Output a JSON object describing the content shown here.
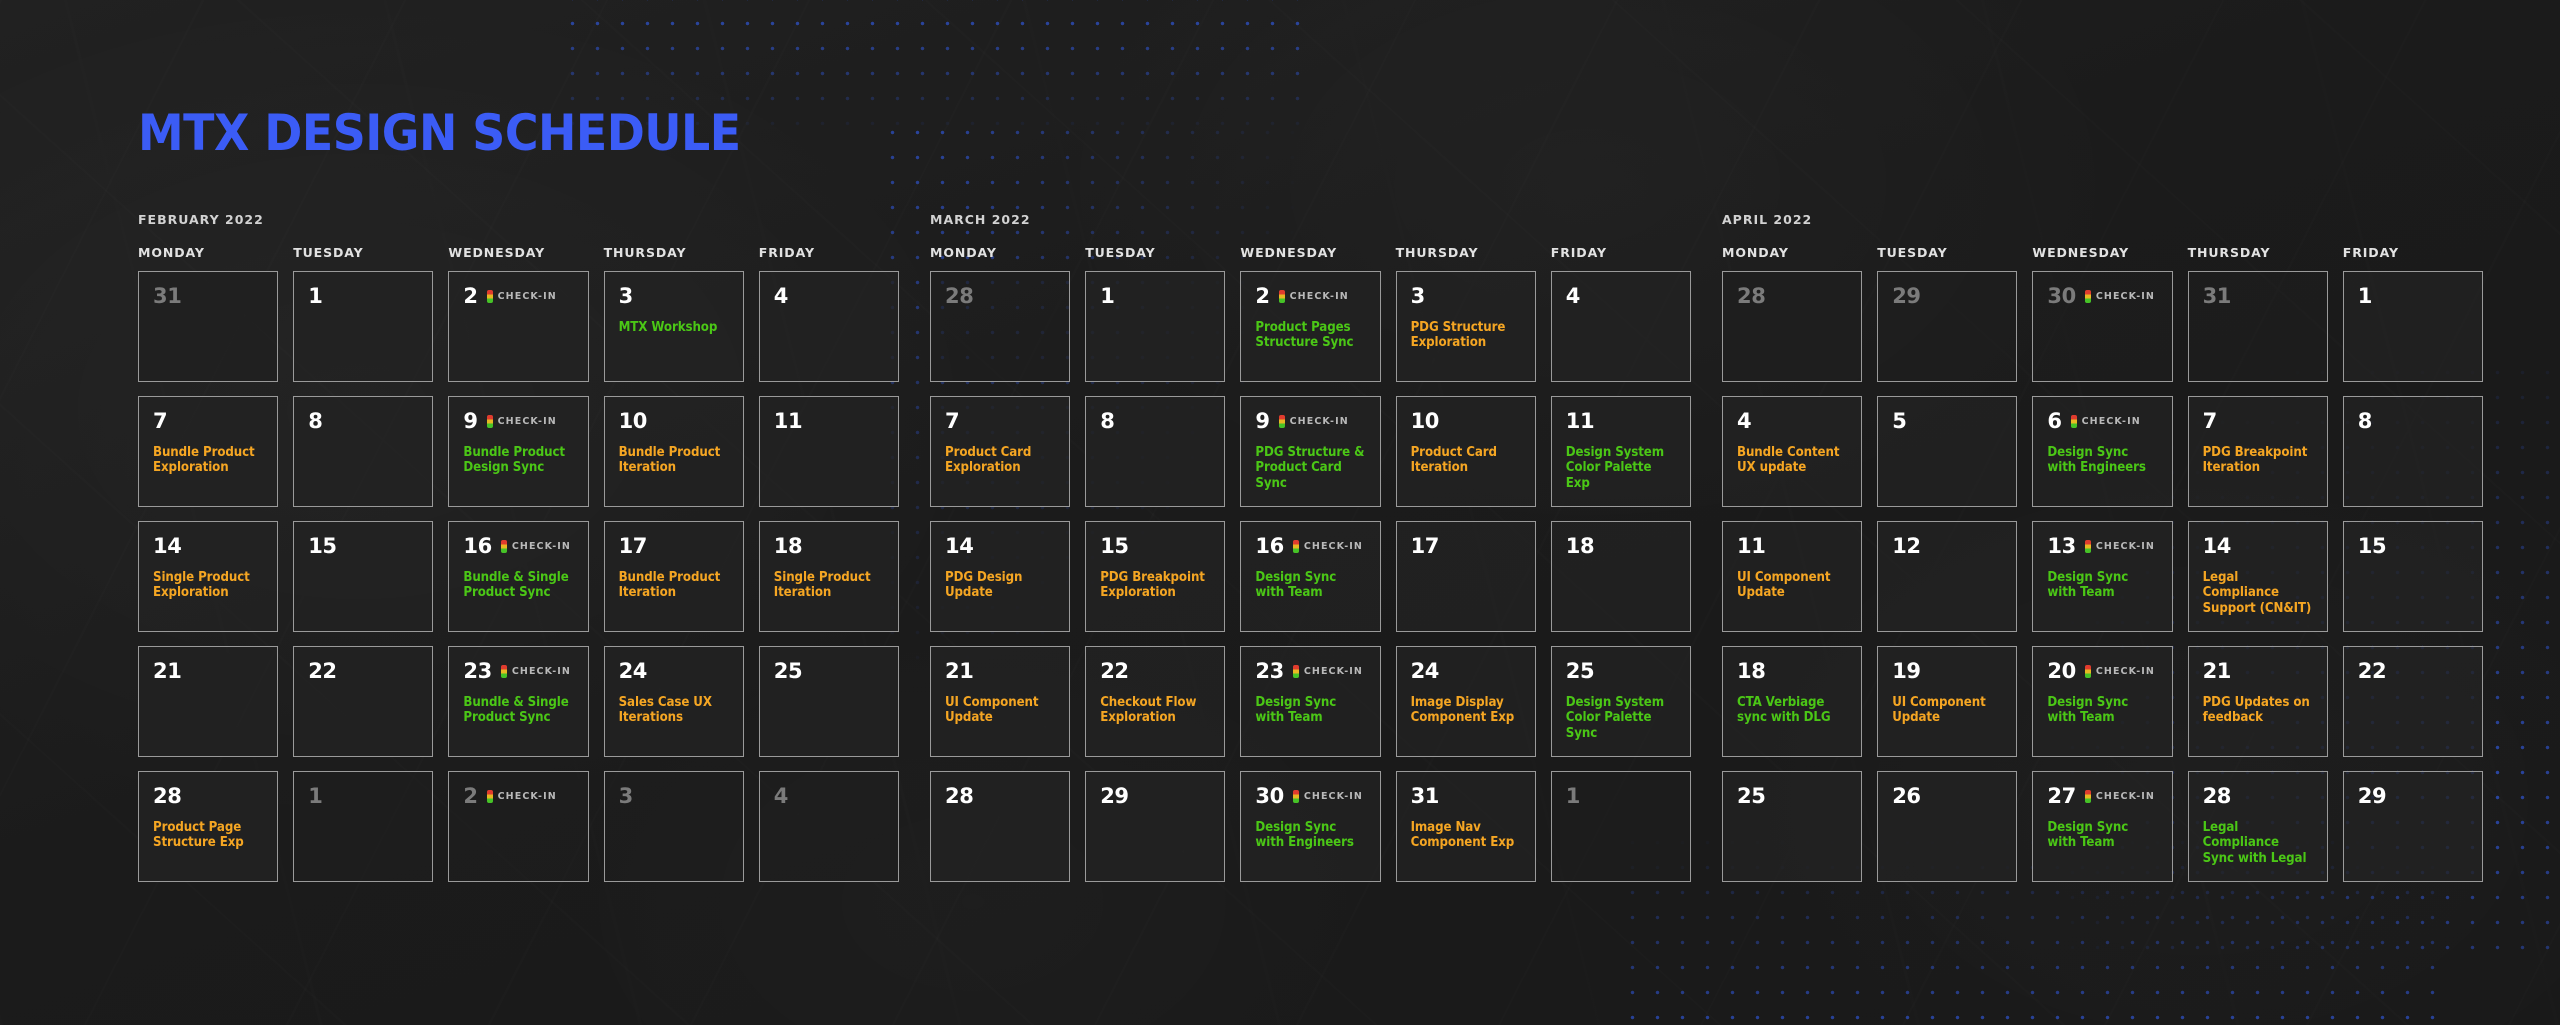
{
  "page": {
    "title": "MTX DESIGN SCHEDULE",
    "title_color": "#3b5cf6",
    "background_color": "#1c1c1c",
    "accent_orange": "#f5a623",
    "accent_green": "#4bc716",
    "cell_border_color": "#9a9a9a",
    "muted_number_color": "#7b7b7b"
  },
  "checkin": {
    "label": "CHECK-IN",
    "icon": "stoplight-icon"
  },
  "weekdays": [
    "MONDAY",
    "TUESDAY",
    "WEDNESDAY",
    "THURSDAY",
    "FRIDAY"
  ],
  "months": [
    {
      "name": "FEBRUARY 2022",
      "weeks": [
        [
          {
            "num": "31",
            "muted": true,
            "checkin": false,
            "event": null,
            "color": null
          },
          {
            "num": "1",
            "muted": false,
            "checkin": false,
            "event": null,
            "color": null
          },
          {
            "num": "2",
            "muted": false,
            "checkin": true,
            "event": null,
            "color": null
          },
          {
            "num": "3",
            "muted": false,
            "checkin": false,
            "event": "MTX Workshop",
            "color": "green"
          },
          {
            "num": "4",
            "muted": false,
            "checkin": false,
            "event": null,
            "color": null
          }
        ],
        [
          {
            "num": "7",
            "muted": false,
            "checkin": false,
            "event": "Bundle Product Exploration",
            "color": "orange"
          },
          {
            "num": "8",
            "muted": false,
            "checkin": false,
            "event": null,
            "color": null
          },
          {
            "num": "9",
            "muted": false,
            "checkin": true,
            "event": "Bundle Product Design Sync",
            "color": "green"
          },
          {
            "num": "10",
            "muted": false,
            "checkin": false,
            "event": "Bundle Product Iteration",
            "color": "orange"
          },
          {
            "num": "11",
            "muted": false,
            "checkin": false,
            "event": null,
            "color": null
          }
        ],
        [
          {
            "num": "14",
            "muted": false,
            "checkin": false,
            "event": "Single Product Exploration",
            "color": "orange"
          },
          {
            "num": "15",
            "muted": false,
            "checkin": false,
            "event": null,
            "color": null
          },
          {
            "num": "16",
            "muted": false,
            "checkin": true,
            "event": "Bundle & Single Product Sync",
            "color": "green"
          },
          {
            "num": "17",
            "muted": false,
            "checkin": false,
            "event": "Bundle Product Iteration",
            "color": "orange"
          },
          {
            "num": "18",
            "muted": false,
            "checkin": false,
            "event": "Single Product Iteration",
            "color": "orange"
          }
        ],
        [
          {
            "num": "21",
            "muted": false,
            "checkin": false,
            "event": null,
            "color": null
          },
          {
            "num": "22",
            "muted": false,
            "checkin": false,
            "event": null,
            "color": null
          },
          {
            "num": "23",
            "muted": false,
            "checkin": true,
            "event": "Bundle & Single Product Sync",
            "color": "green"
          },
          {
            "num": "24",
            "muted": false,
            "checkin": false,
            "event": "Sales Case UX Iterations",
            "color": "orange"
          },
          {
            "num": "25",
            "muted": false,
            "checkin": false,
            "event": null,
            "color": null
          }
        ],
        [
          {
            "num": "28",
            "muted": false,
            "checkin": false,
            "event": "Product Page Structure Exp",
            "color": "orange"
          },
          {
            "num": "1",
            "muted": true,
            "checkin": false,
            "event": null,
            "color": null
          },
          {
            "num": "2",
            "muted": true,
            "checkin": true,
            "event": null,
            "color": null
          },
          {
            "num": "3",
            "muted": true,
            "checkin": false,
            "event": null,
            "color": null
          },
          {
            "num": "4",
            "muted": true,
            "checkin": false,
            "event": null,
            "color": null
          }
        ]
      ]
    },
    {
      "name": "MARCH 2022",
      "weeks": [
        [
          {
            "num": "28",
            "muted": true,
            "checkin": false,
            "event": null,
            "color": null
          },
          {
            "num": "1",
            "muted": false,
            "checkin": false,
            "event": null,
            "color": null
          },
          {
            "num": "2",
            "muted": false,
            "checkin": true,
            "event": "Product Pages Structure Sync",
            "color": "green"
          },
          {
            "num": "3",
            "muted": false,
            "checkin": false,
            "event": "PDG Structure Exploration",
            "color": "orange"
          },
          {
            "num": "4",
            "muted": false,
            "checkin": false,
            "event": null,
            "color": null
          }
        ],
        [
          {
            "num": "7",
            "muted": false,
            "checkin": false,
            "event": "Product Card Exploration",
            "color": "orange"
          },
          {
            "num": "8",
            "muted": false,
            "checkin": false,
            "event": null,
            "color": null
          },
          {
            "num": "9",
            "muted": false,
            "checkin": true,
            "event": "PDG Structure & Product Card Sync",
            "color": "green"
          },
          {
            "num": "10",
            "muted": false,
            "checkin": false,
            "event": "Product Card Iteration",
            "color": "orange"
          },
          {
            "num": "11",
            "muted": false,
            "checkin": false,
            "event": "Design System Color Palette Exp",
            "color": "green"
          }
        ],
        [
          {
            "num": "14",
            "muted": false,
            "checkin": false,
            "event": "PDG Design Update",
            "color": "orange"
          },
          {
            "num": "15",
            "muted": false,
            "checkin": false,
            "event": "PDG Breakpoint Exploration",
            "color": "orange"
          },
          {
            "num": "16",
            "muted": false,
            "checkin": true,
            "event": "Design Sync with Team",
            "color": "green"
          },
          {
            "num": "17",
            "muted": false,
            "checkin": false,
            "event": null,
            "color": null
          },
          {
            "num": "18",
            "muted": false,
            "checkin": false,
            "event": null,
            "color": null
          }
        ],
        [
          {
            "num": "21",
            "muted": false,
            "checkin": false,
            "event": "UI Component Update",
            "color": "orange"
          },
          {
            "num": "22",
            "muted": false,
            "checkin": false,
            "event": "Checkout Flow Exploration",
            "color": "orange"
          },
          {
            "num": "23",
            "muted": false,
            "checkin": true,
            "event": "Design Sync with Team",
            "color": "green"
          },
          {
            "num": "24",
            "muted": false,
            "checkin": false,
            "event": "Image Display Component Exp",
            "color": "orange"
          },
          {
            "num": "25",
            "muted": false,
            "checkin": false,
            "event": "Design System Color Palette Sync",
            "color": "green"
          }
        ],
        [
          {
            "num": "28",
            "muted": false,
            "checkin": false,
            "event": null,
            "color": null
          },
          {
            "num": "29",
            "muted": false,
            "checkin": false,
            "event": null,
            "color": null
          },
          {
            "num": "30",
            "muted": false,
            "checkin": true,
            "event": "Design Sync with Engineers",
            "color": "green"
          },
          {
            "num": "31",
            "muted": false,
            "checkin": false,
            "event": "Image Nav Component Exp",
            "color": "orange"
          },
          {
            "num": "1",
            "muted": true,
            "checkin": false,
            "event": null,
            "color": null
          }
        ]
      ]
    },
    {
      "name": "APRIL 2022",
      "weeks": [
        [
          {
            "num": "28",
            "muted": true,
            "checkin": false,
            "event": null,
            "color": null
          },
          {
            "num": "29",
            "muted": true,
            "checkin": false,
            "event": null,
            "color": null
          },
          {
            "num": "30",
            "muted": true,
            "checkin": true,
            "event": null,
            "color": null
          },
          {
            "num": "31",
            "muted": true,
            "checkin": false,
            "event": null,
            "color": null
          },
          {
            "num": "1",
            "muted": false,
            "checkin": false,
            "event": null,
            "color": null
          }
        ],
        [
          {
            "num": "4",
            "muted": false,
            "checkin": false,
            "event": "Bundle Content UX update",
            "color": "orange"
          },
          {
            "num": "5",
            "muted": false,
            "checkin": false,
            "event": null,
            "color": null
          },
          {
            "num": "6",
            "muted": false,
            "checkin": true,
            "event": "Design Sync with Engineers",
            "color": "green"
          },
          {
            "num": "7",
            "muted": false,
            "checkin": false,
            "event": "PDG Breakpoint Iteration",
            "color": "orange"
          },
          {
            "num": "8",
            "muted": false,
            "checkin": false,
            "event": null,
            "color": null
          }
        ],
        [
          {
            "num": "11",
            "muted": false,
            "checkin": false,
            "event": "UI Component Update",
            "color": "orange"
          },
          {
            "num": "12",
            "muted": false,
            "checkin": false,
            "event": null,
            "color": null
          },
          {
            "num": "13",
            "muted": false,
            "checkin": true,
            "event": "Design Sync with Team",
            "color": "green"
          },
          {
            "num": "14",
            "muted": false,
            "checkin": false,
            "event": "Legal Compliance Support (CN&IT)",
            "color": "orange"
          },
          {
            "num": "15",
            "muted": false,
            "checkin": false,
            "event": null,
            "color": null
          }
        ],
        [
          {
            "num": "18",
            "muted": false,
            "checkin": false,
            "event": "CTA Verbiage sync with DLG",
            "color": "green"
          },
          {
            "num": "19",
            "muted": false,
            "checkin": false,
            "event": "UI Component Update",
            "color": "orange"
          },
          {
            "num": "20",
            "muted": false,
            "checkin": true,
            "event": "Design Sync with Team",
            "color": "green"
          },
          {
            "num": "21",
            "muted": false,
            "checkin": false,
            "event": "PDG Updates on feedback",
            "color": "orange"
          },
          {
            "num": "22",
            "muted": false,
            "checkin": false,
            "event": null,
            "color": null
          }
        ],
        [
          {
            "num": "25",
            "muted": false,
            "checkin": false,
            "event": null,
            "color": null
          },
          {
            "num": "26",
            "muted": false,
            "checkin": false,
            "event": null,
            "color": null
          },
          {
            "num": "27",
            "muted": false,
            "checkin": true,
            "event": "Design Sync with Team",
            "color": "green"
          },
          {
            "num": "28",
            "muted": false,
            "checkin": false,
            "event": "Legal Compliance Sync with Legal",
            "color": "green"
          },
          {
            "num": "29",
            "muted": false,
            "checkin": false,
            "event": null,
            "color": null
          }
        ]
      ]
    }
  ]
}
